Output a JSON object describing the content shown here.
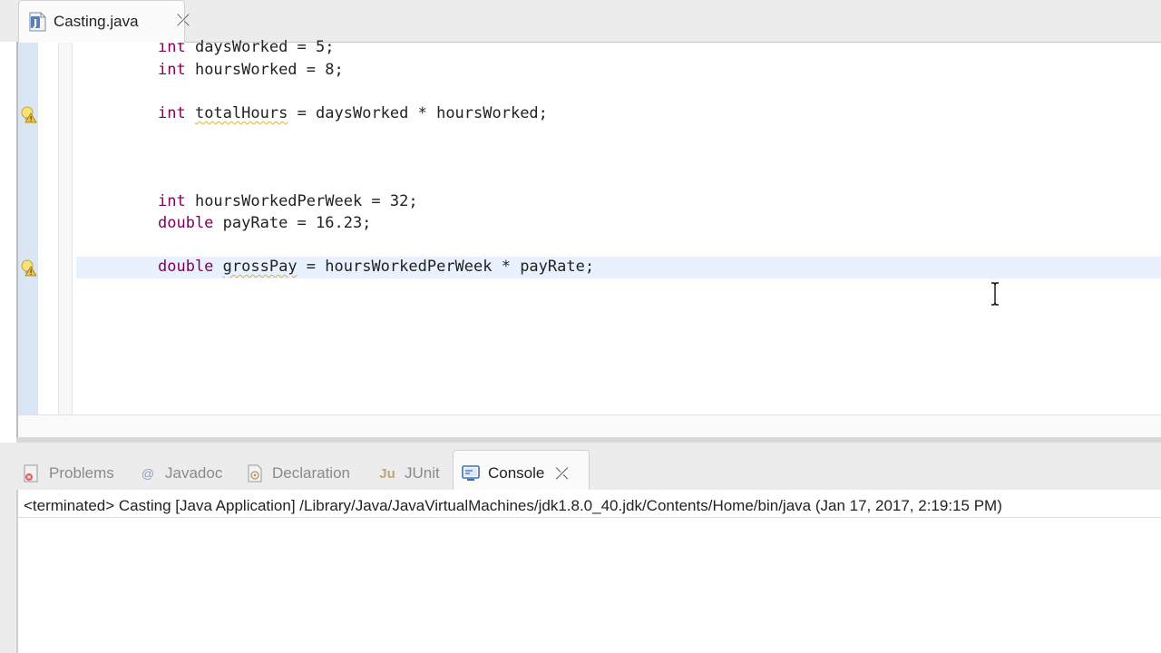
{
  "editor": {
    "tab": {
      "title": "Casting.java",
      "close_glyph": "⤫",
      "icon": "java-file-icon"
    },
    "lines": [
      {
        "segments": [
          {
            "t": "int",
            "kw": true
          },
          {
            "t": " daysWorked = 5;"
          }
        ]
      },
      {
        "segments": [
          {
            "t": "int",
            "kw": true
          },
          {
            "t": " hoursWorked = 8;"
          }
        ]
      },
      {
        "segments": [
          {
            "t": "int",
            "kw": true
          },
          {
            "t": " "
          },
          {
            "t": "totalHours",
            "warn": true
          },
          {
            "t": " = daysWorked * hoursWorked;"
          }
        ]
      },
      {
        "segments": [
          {
            "t": "int",
            "kw": true
          },
          {
            "t": " hoursWorkedPerWeek = 32;"
          }
        ]
      },
      {
        "segments": [
          {
            "t": "double",
            "kw": true
          },
          {
            "t": " payRate = 16.23;"
          }
        ]
      },
      {
        "segments": [
          {
            "t": "double",
            "kw": true
          },
          {
            "t": " "
          },
          {
            "t": "grossPay",
            "warn": true
          },
          {
            "t": " = hoursWorkedPerWeek * payRate;"
          }
        ]
      }
    ],
    "warning_icon": "warning-lightbulb-icon",
    "colors": {
      "keyword": "#7f0055",
      "warning_underline": "#e0b030",
      "current_line": "#e8f2fe",
      "ruler": "#dbe6f4"
    }
  },
  "panel": {
    "tabs": [
      {
        "label": "Problems",
        "icon": "problems-icon"
      },
      {
        "label": "Javadoc",
        "icon": "at-sign-icon"
      },
      {
        "label": "Declaration",
        "icon": "declaration-icon"
      },
      {
        "label": "JUnit",
        "icon": "junit-icon"
      },
      {
        "label": "Console",
        "icon": "console-icon",
        "active": true
      }
    ],
    "console_close_glyph": "⤫",
    "console_status": "<terminated> Casting [Java Application] /Library/Java/JavaVirtualMachines/jdk1.8.0_40.jdk/Contents/Home/bin/java (Jan 17, 2017, 2:19:15 PM)"
  }
}
